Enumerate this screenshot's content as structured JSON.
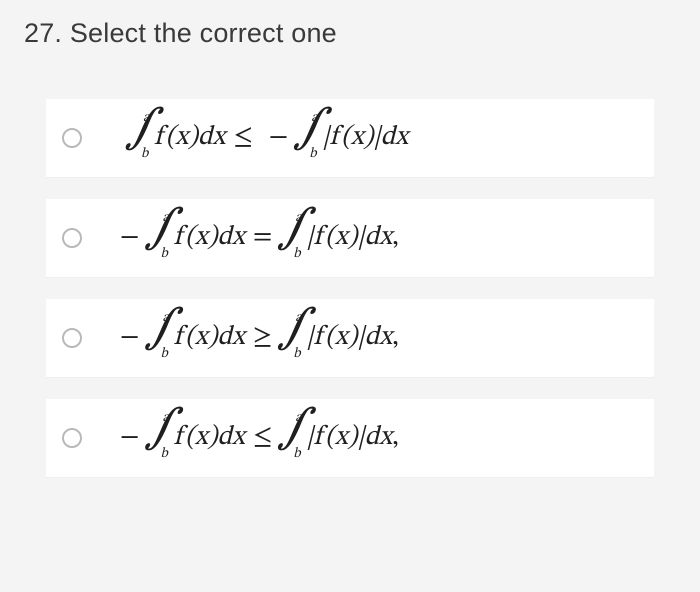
{
  "question": {
    "number": "27.",
    "text": "Select the correct one"
  },
  "int": {
    "symbol": "∫",
    "upper": "a",
    "lower": "b"
  },
  "body1": "f (x)dx",
  "body2": "|f (x)|dx",
  "ops": {
    "le": "≤",
    "ge": "≥",
    "eq": "=",
    "minus": "−"
  },
  "trail": {
    "none": "",
    "comma": ","
  },
  "options": [
    {
      "lead": "none",
      "rel": "le",
      "tr": "none"
    },
    {
      "lead": "minus",
      "rel": "eq",
      "tr": "comma"
    },
    {
      "lead": "minus",
      "rel": "ge",
      "tr": "comma"
    },
    {
      "lead": "minus",
      "rel": "le",
      "tr": "comma"
    }
  ]
}
